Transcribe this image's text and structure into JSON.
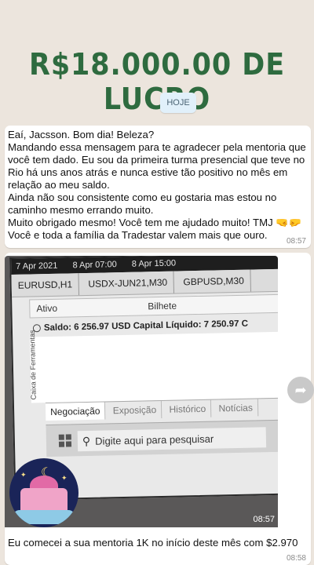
{
  "story": {
    "headline": "R$18.000.00 DE LUCRO"
  },
  "chat": {
    "date_label": "HOJE",
    "messages": [
      {
        "lines": [
          "Eaí, Jacsson. Bom dia! Beleza?",
          "Mandando essa mensagem para te agradecer pela mentoria que você tem dado. Eu sou da primeira turma presencial que teve no Rio há uns anos atrás e nunca estive tão positivo no mês em relação ao meu saldo.",
          "Ainda não sou consistente como eu gostaria mas estou no caminho mesmo errando muito.",
          "Muito obrigado mesmo! Você tem me ajudado muito! TMJ 🤜🤛",
          "Você e toda a família da Tradestar valem mais que ouro."
        ],
        "time": "08:57"
      },
      {
        "photo": {
          "screen": {
            "time_axis": [
              "7 Apr 2021",
              "8 Apr 07:00",
              "8 Apr 15:00"
            ],
            "symbol_tabs": [
              "EURUSD,H1",
              "USDX-JUN21,M30",
              "GBPUSD,M30"
            ],
            "table_headers": [
              "Ativo",
              "Bilhete"
            ],
            "balance_line": "Saldo: 6 256.97 USD  Capital Líquido: 7 250.97  C",
            "toolbox_label": "Caixa de Ferramentas",
            "bottom_tabs": [
              "Negociação",
              "Exposição",
              "Histórico",
              "Notícias"
            ],
            "search_placeholder": "Digite aqui para pesquisar"
          },
          "overlay_time": "08:57"
        },
        "caption": "Eu comecei a sua mentoria 1K no início deste mês com $2.970",
        "time": "08:58"
      }
    ]
  },
  "icons": {
    "forward": "forward-arrow-icon",
    "windows": "windows-logo-icon",
    "search": "search-icon",
    "sticker": "mosque-moon-sticker"
  },
  "colors": {
    "headline": "#2e6b3f",
    "chat_bg": "#ece5dd",
    "bubble": "#ffffff"
  }
}
